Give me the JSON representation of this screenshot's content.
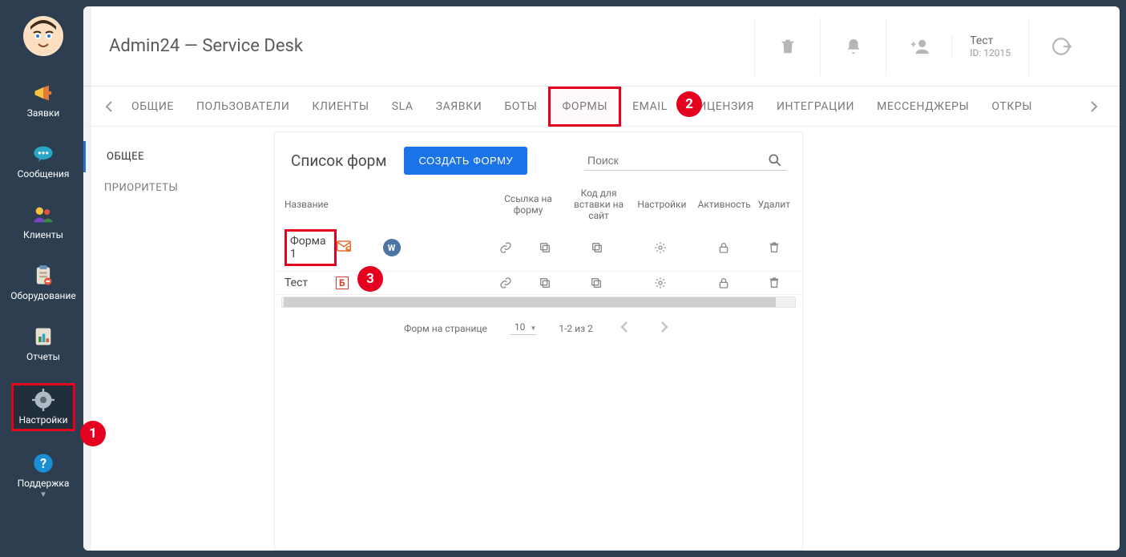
{
  "sidebar": {
    "items": [
      {
        "label": "Заявки"
      },
      {
        "label": "Сообщения"
      },
      {
        "label": "Клиенты"
      },
      {
        "label": "Оборудование"
      },
      {
        "label": "Отчеты"
      },
      {
        "label": "Настройки"
      },
      {
        "label": "Поддержка"
      }
    ]
  },
  "header": {
    "title": "Admin24 — Service Desk",
    "user_name": "Тест",
    "user_id_label": "ID: 12015"
  },
  "tabs": [
    "ОБЩИЕ",
    "ПОЛЬЗОВАТЕЛИ",
    "КЛИЕНТЫ",
    "SLA",
    "ЗАЯВКИ",
    "БОТЫ",
    "ФОРМЫ",
    "EMAIL",
    "ЛИЦЕНЗИЯ",
    "ИНТЕГРАЦИИ",
    "МЕССЕНДЖЕРЫ",
    "ОТКРЫ"
  ],
  "subnav": [
    "ОБЩЕЕ",
    "ПРИОРИТЕТЫ"
  ],
  "forms": {
    "title": "Список форм",
    "create_label": "СОЗДАТЬ ФОРМУ",
    "search_placeholder": "Поиск",
    "columns": {
      "name": "Название",
      "link": "Ссылка на форму",
      "embed": "Код для вставки на сайт",
      "settings": "Настройки",
      "activity": "Активность",
      "delete": "Удалит"
    },
    "rows": [
      {
        "name": "Форма 1",
        "integrations": [
          "mail",
          "vk"
        ]
      },
      {
        "name": "Тест",
        "integrations": [
          "b24"
        ]
      }
    ],
    "footer": {
      "per_page_label": "Форм на странице",
      "page_size": "10",
      "range": "1-2 из 2"
    }
  },
  "callouts": {
    "c1": "1",
    "c2": "2",
    "c3": "3"
  }
}
